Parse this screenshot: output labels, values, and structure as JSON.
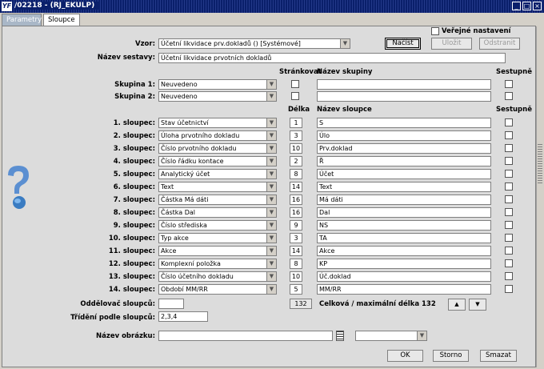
{
  "window": {
    "title": "/02218 - (RJ_EKULP)"
  },
  "tabs": [
    {
      "label": "Parametry"
    },
    {
      "label": "Sloupce"
    }
  ],
  "header": {
    "public_label": "Veřejné nastavení",
    "vzor_label": "Vzor:",
    "vzor_value": "Účetní likvidace prv.dokladů  ()  [Systémové]",
    "nacist": "Načíst",
    "ulozit": "Uložit",
    "odstranit": "Odstranit",
    "nazev_label": "Název sestavy:",
    "nazev_value": "Účetní likvidace prvotních dokladů"
  },
  "groups": {
    "col_strankovat": "Stránkovat",
    "col_nazev": "Název skupiny",
    "col_sestupne": "Sestupně",
    "items": [
      {
        "label": "Skupina 1:",
        "value": "Neuvedeno",
        "name": ""
      },
      {
        "label": "Skupina 2:",
        "value": "Neuvedeno",
        "name": ""
      }
    ]
  },
  "columns": {
    "col_delka": "Délka",
    "col_nazev": "Název sloupce",
    "col_sestupne": "Sestupně",
    "items": [
      {
        "label": "1. sloupec:",
        "value": "Stav účetnictví",
        "len": "1",
        "name": "S"
      },
      {
        "label": "2. sloupec:",
        "value": "Úloha prvotního dokladu",
        "len": "3",
        "name": "Úlo"
      },
      {
        "label": "3. sloupec:",
        "value": "Číslo prvotního dokladu",
        "len": "10",
        "name": "Prv.doklad"
      },
      {
        "label": "4. sloupec:",
        "value": "Číslo řádku kontace",
        "len": "2",
        "name": "Ř"
      },
      {
        "label": "5. sloupec:",
        "value": "Analytický účet",
        "len": "8",
        "name": "Účet"
      },
      {
        "label": "6. sloupec:",
        "value": "Text",
        "len": "14",
        "name": "Text"
      },
      {
        "label": "7. sloupec:",
        "value": "Částka Má dáti",
        "len": "16",
        "name": "Má dáti"
      },
      {
        "label": "8. sloupec:",
        "value": "Částka Dal",
        "len": "16",
        "name": "Dal"
      },
      {
        "label": "9. sloupec:",
        "value": "Číslo střediska",
        "len": "9",
        "name": "NS"
      },
      {
        "label": "10. sloupec:",
        "value": "Typ akce",
        "len": "3",
        "name": "TA"
      },
      {
        "label": "11. sloupec:",
        "value": "Akce",
        "len": "14",
        "name": "Akce"
      },
      {
        "label": "12. sloupec:",
        "value": "Komplexní položka",
        "len": "8",
        "name": "KP"
      },
      {
        "label": "13. sloupec:",
        "value": "Číslo účetního dokladu",
        "len": "10",
        "name": "Úč.doklad"
      },
      {
        "label": "14. sloupec:",
        "value": "Období MM/RR",
        "len": "5",
        "name": "MM/RR"
      }
    ]
  },
  "footer": {
    "oddelovac_label": "Oddělovač sloupců:",
    "oddelovac_value": "",
    "total_len": "132",
    "total_text": "Celková / maximální délka 132",
    "trideni_label": "Třídění podle sloupců:",
    "trideni_value": "2,3,4",
    "obrazek_label": "Název obrázku:",
    "obrazek_value": "",
    "ok": "OK",
    "storno": "Storno",
    "smazat": "Smazat"
  },
  "icons": {
    "app": "app-icon",
    "help": "help-question-icon"
  },
  "colors": {
    "titlebar": "#0a1f6b",
    "tab_inactive": "#a9b7c7",
    "panel": "#dcdcdc"
  }
}
